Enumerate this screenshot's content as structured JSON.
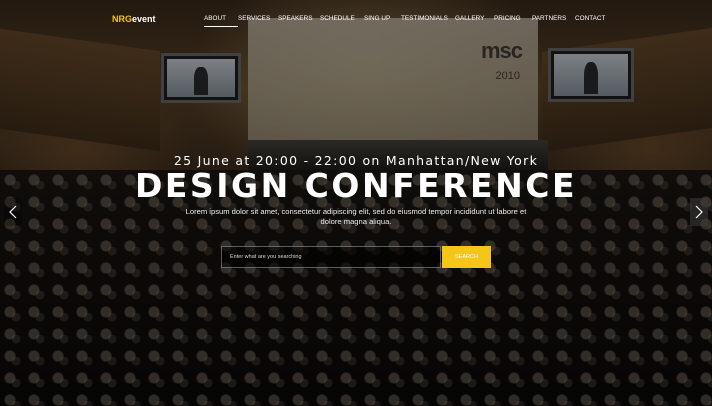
{
  "logo": {
    "part1": "NRG",
    "part2": "event"
  },
  "nav": [
    {
      "label": "ABOUT",
      "active": true
    },
    {
      "label": "SERVICES",
      "active": false
    },
    {
      "label": "SPEAKERS",
      "active": false
    },
    {
      "label": "SCHEDULE",
      "active": false
    },
    {
      "label": "SING UP",
      "active": false
    },
    {
      "label": "TESTIMONIALS",
      "active": false
    },
    {
      "label": "GALLERY",
      "active": false
    },
    {
      "label": "PRICING",
      "active": false
    },
    {
      "label": "PARTNERS",
      "active": false
    },
    {
      "label": "CONTACT",
      "active": false
    }
  ],
  "hero": {
    "date_line": "25 June at 20:00 - 22:00 on Manhattan/New York",
    "title": "DESIGN CONFERENCE",
    "description": "Lorem ipsum dolor sit amet, consectetur adipiscing elit, sed do eiusmod tempor incididunt ut labore et dolore magna aliqua."
  },
  "search": {
    "placeholder": "Enter what are you searching",
    "value": "",
    "button_label": "SEARCH"
  },
  "background_sign": {
    "text": "msc",
    "year": "2010"
  },
  "icons": {
    "prev": "chevron-left-icon",
    "next": "chevron-right-icon"
  },
  "colors": {
    "accent": "#f5c518",
    "text": "#ffffff"
  }
}
